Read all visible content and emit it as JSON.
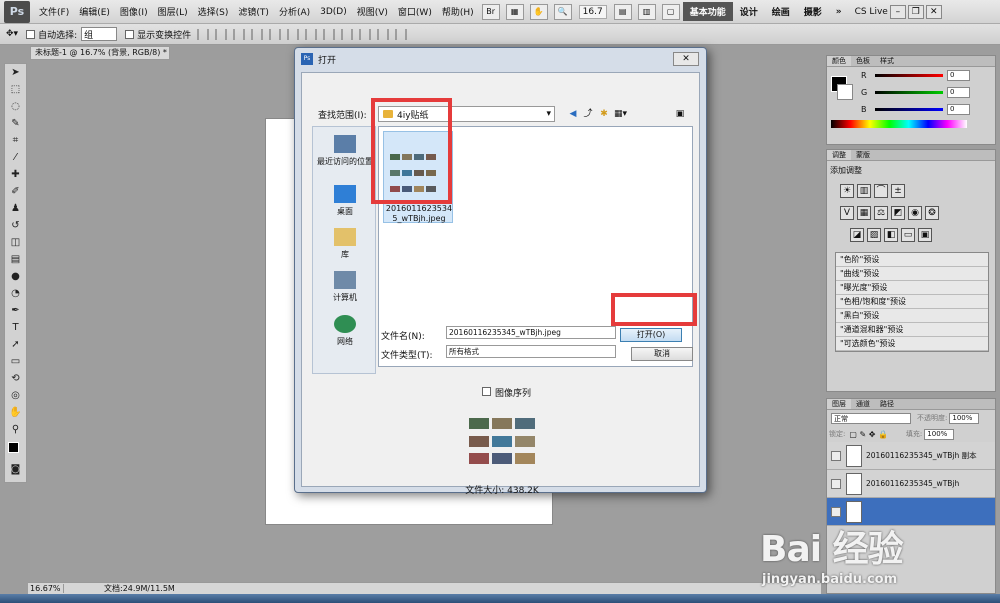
{
  "app": {
    "logo": "Ps"
  },
  "menubar": {
    "items": [
      "文件(F)",
      "编辑(E)",
      "图像(I)",
      "图层(L)",
      "选择(S)",
      "滤镜(T)",
      "分析(A)",
      "3D(D)",
      "视图(V)",
      "窗口(W)",
      "帮助(H)"
    ],
    "zoom": "16.7",
    "workspaces": [
      "基本功能",
      "设计",
      "绘画",
      "摄影"
    ],
    "more": "»",
    "cslive": "CS Live"
  },
  "options_bar": {
    "auto_select": "自动选择:",
    "group": "组",
    "show_transform": "显示变换控件"
  },
  "document": {
    "tab": "未标题-1 @ 16.7% (背景, RGB/8) *"
  },
  "status": {
    "zoom": "16.67%",
    "doc_size": "文档:24.9M/11.5M"
  },
  "panels": {
    "color": {
      "tabs": [
        "颜色",
        "色板",
        "样式"
      ],
      "channels": [
        {
          "label": "R",
          "value": "0"
        },
        {
          "label": "G",
          "value": "0"
        },
        {
          "label": "B",
          "value": "0"
        }
      ]
    },
    "adjust": {
      "tabs": [
        "调整",
        "蒙版"
      ],
      "title": "添加调整"
    },
    "presets": [
      "\"色阶\"预设",
      "\"曲线\"预设",
      "\"曝光度\"预设",
      "\"色相/饱和度\"预设",
      "\"黑白\"预设",
      "\"通道混和器\"预设",
      "\"可选颜色\"预设"
    ],
    "layers": {
      "tabs": [
        "图层",
        "通道",
        "路径"
      ],
      "blend": "正常",
      "opacity_label": "不透明度:",
      "opacity": "100%",
      "lock_label": "锁定:",
      "fill_label": "填充:",
      "fill": "100%",
      "items": [
        "20160116235345_wTBjh 副本",
        "20160116235345_wTBjh"
      ]
    }
  },
  "dialog": {
    "title": "打开",
    "close": "✕",
    "look_in_label": "查找范围(I):",
    "look_in_value": "4iy贴纸",
    "places": [
      "最近访问的位置",
      "桌面",
      "库",
      "计算机",
      "网络"
    ],
    "file_name_in_list": "20160116235345_wTBjh.jpeg",
    "file_name_label": "文件名(N):",
    "file_name_value": "20160116235345_wTBjh.jpeg",
    "file_type_label": "文件类型(T):",
    "file_type_value": "所有格式",
    "open_button": "打开(O)",
    "cancel_button": "取消",
    "sequence_label": "图像序列",
    "file_size": "文件大小: 438.2K"
  },
  "watermark": {
    "logo": "Bai 经验",
    "url": "jingyan.baidu.com"
  },
  "colors": {
    "highlight_red": "#e53b3b",
    "ps_dark": "#4c4c4c",
    "dialog_frame": "#d5dde8"
  }
}
